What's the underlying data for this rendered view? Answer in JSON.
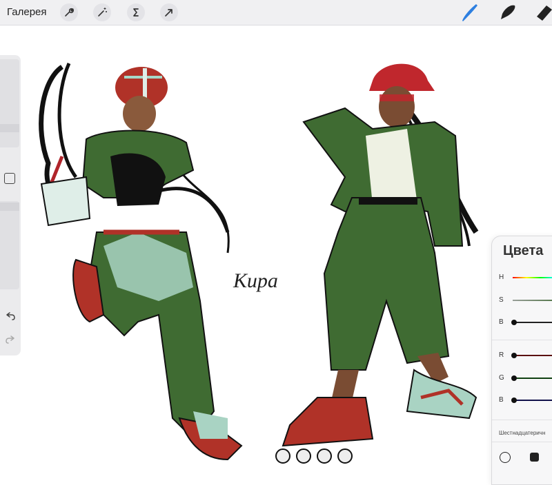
{
  "toolbar": {
    "gallery_label": "Галерея",
    "left_icons": [
      "wrench-icon",
      "magic-wand-icon",
      "selection-s-icon",
      "transform-arrow-icon"
    ],
    "right_tools": [
      "brush-tool-icon",
      "smudge-tool-icon",
      "eraser-tool-icon"
    ],
    "active_tool_color": "#2d7fe0"
  },
  "canvas": {
    "signature": "Кира"
  },
  "colors_panel": {
    "title": "Цвета",
    "hsb": [
      {
        "label": "H"
      },
      {
        "label": "S"
      },
      {
        "label": "B"
      }
    ],
    "rgb": [
      {
        "label": "R"
      },
      {
        "label": "G"
      },
      {
        "label": "B"
      }
    ],
    "hex_label": "Шестнадцатеричн"
  }
}
